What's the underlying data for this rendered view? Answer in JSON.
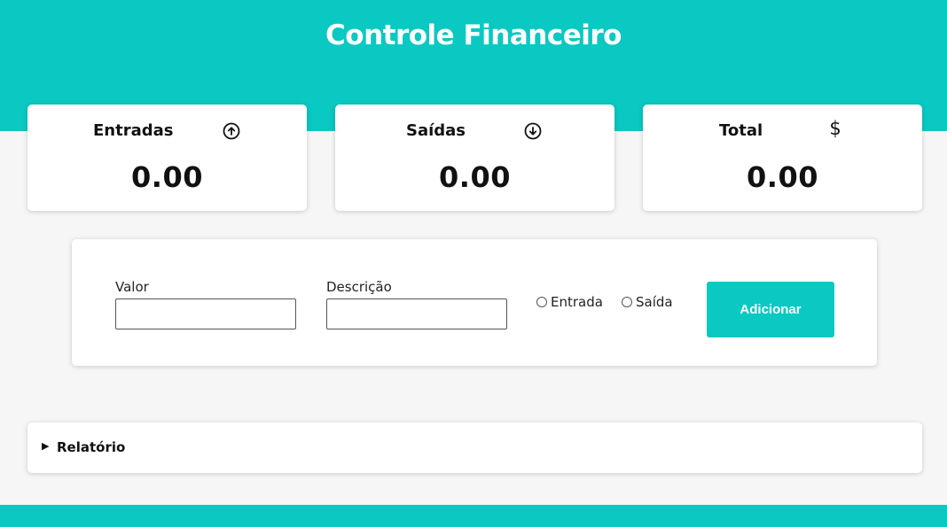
{
  "header": {
    "title": "Controle Financeiro"
  },
  "cards": [
    {
      "label": "Entradas",
      "value": "0.00",
      "icon": "arrow-up-circle-icon"
    },
    {
      "label": "Saídas",
      "value": "0.00",
      "icon": "arrow-down-circle-icon"
    },
    {
      "label": "Total",
      "value": "0.00",
      "icon": "$"
    }
  ],
  "form": {
    "valor_label": "Valor",
    "valor_value": "",
    "descricao_label": "Descrição",
    "descricao_value": "",
    "radio_entrada": "Entrada",
    "radio_saida": "Saída",
    "submit_label": "Adicionar"
  },
  "report": {
    "title": "Relatório",
    "toggle": "▶"
  },
  "colors": {
    "accent": "#09c9c2",
    "background": "#f6f6f6",
    "card": "#ffffff"
  }
}
